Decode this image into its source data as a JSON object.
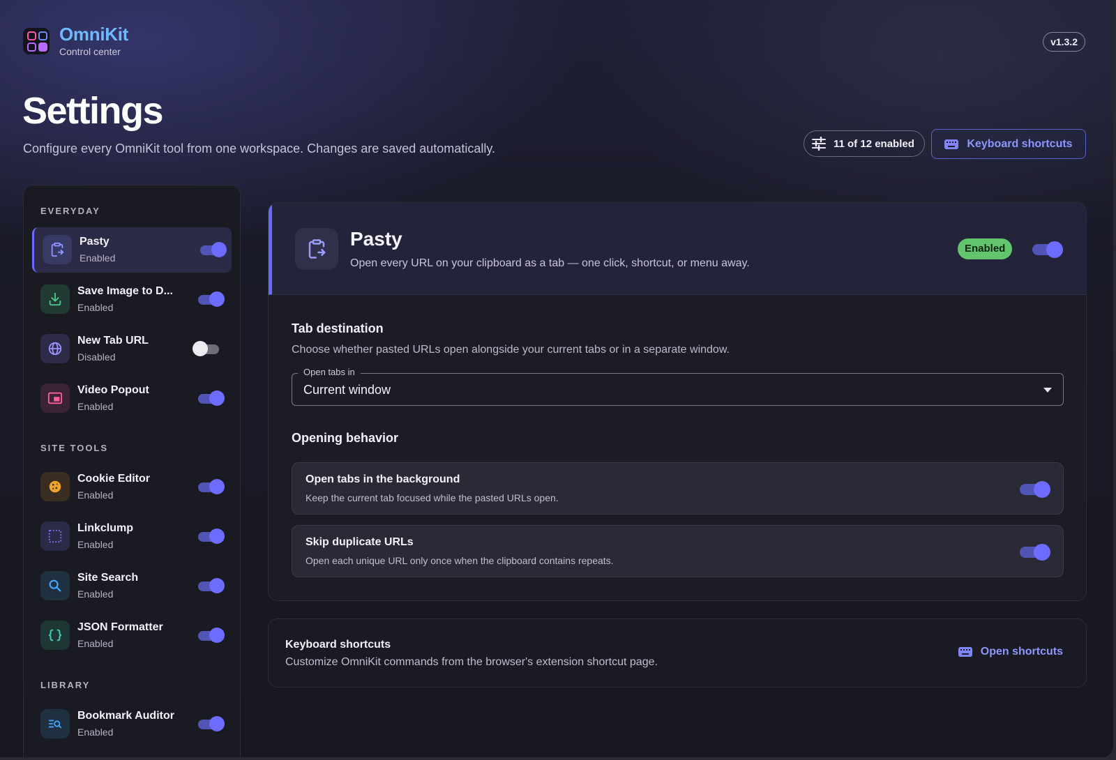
{
  "brand": {
    "name": "OmniKit",
    "subtitle": "Control center",
    "version": "v1.3.2"
  },
  "page": {
    "title": "Settings",
    "description": "Configure every OmniKit tool from one workspace. Changes are saved automatically.",
    "enabled_count": "11 of 12 enabled",
    "shortcuts_button": "Keyboard shortcuts"
  },
  "sidebar": {
    "sections": [
      {
        "title": "EVERYDAY",
        "items": [
          {
            "name": "Pasty",
            "status": "Enabled",
            "enabled": true,
            "active": true,
            "icon": "clipboard-icon"
          },
          {
            "name": "Save Image to D...",
            "status": "Enabled",
            "enabled": true,
            "active": false,
            "icon": "download-icon"
          },
          {
            "name": "New Tab URL",
            "status": "Disabled",
            "enabled": false,
            "active": false,
            "icon": "globe-icon"
          },
          {
            "name": "Video Popout",
            "status": "Enabled",
            "enabled": true,
            "active": false,
            "icon": "picture-in-picture-icon"
          }
        ]
      },
      {
        "title": "SITE TOOLS",
        "items": [
          {
            "name": "Cookie Editor",
            "status": "Enabled",
            "enabled": true,
            "active": false,
            "icon": "cookie-icon"
          },
          {
            "name": "Linkclump",
            "status": "Enabled",
            "enabled": true,
            "active": false,
            "icon": "selection-icon"
          },
          {
            "name": "Site Search",
            "status": "Enabled",
            "enabled": true,
            "active": false,
            "icon": "search-icon"
          },
          {
            "name": "JSON Formatter",
            "status": "Enabled",
            "enabled": true,
            "active": false,
            "icon": "braces-icon"
          }
        ]
      },
      {
        "title": "LIBRARY",
        "items": [
          {
            "name": "Bookmark Auditor",
            "status": "Enabled",
            "enabled": true,
            "active": false,
            "icon": "bookmark-search-icon"
          }
        ]
      }
    ]
  },
  "tool": {
    "name": "Pasty",
    "description": "Open every URL on your clipboard as a tab — one click, shortcut, or menu away.",
    "badge": "Enabled",
    "enabled": true,
    "tab_destination": {
      "title": "Tab destination",
      "description": "Choose whether pasted URLs open alongside your current tabs or in a separate window.",
      "select_label": "Open tabs in",
      "select_value": "Current window"
    },
    "opening_behavior": {
      "title": "Opening behavior",
      "options": [
        {
          "title": "Open tabs in the background",
          "description": "Keep the current tab focused while the pasted URLs open.",
          "enabled": true
        },
        {
          "title": "Skip duplicate URLs",
          "description": "Open each unique URL only once when the clipboard contains repeats.",
          "enabled": true
        }
      ]
    }
  },
  "shortcuts_card": {
    "title": "Keyboard shortcuts",
    "description": "Customize OmniKit commands from the browser's extension shortcut page.",
    "link": "Open shortcuts"
  },
  "colors": {
    "accent": "#6d6cff",
    "brand": "#6fb9ff",
    "success": "#62c46d"
  }
}
